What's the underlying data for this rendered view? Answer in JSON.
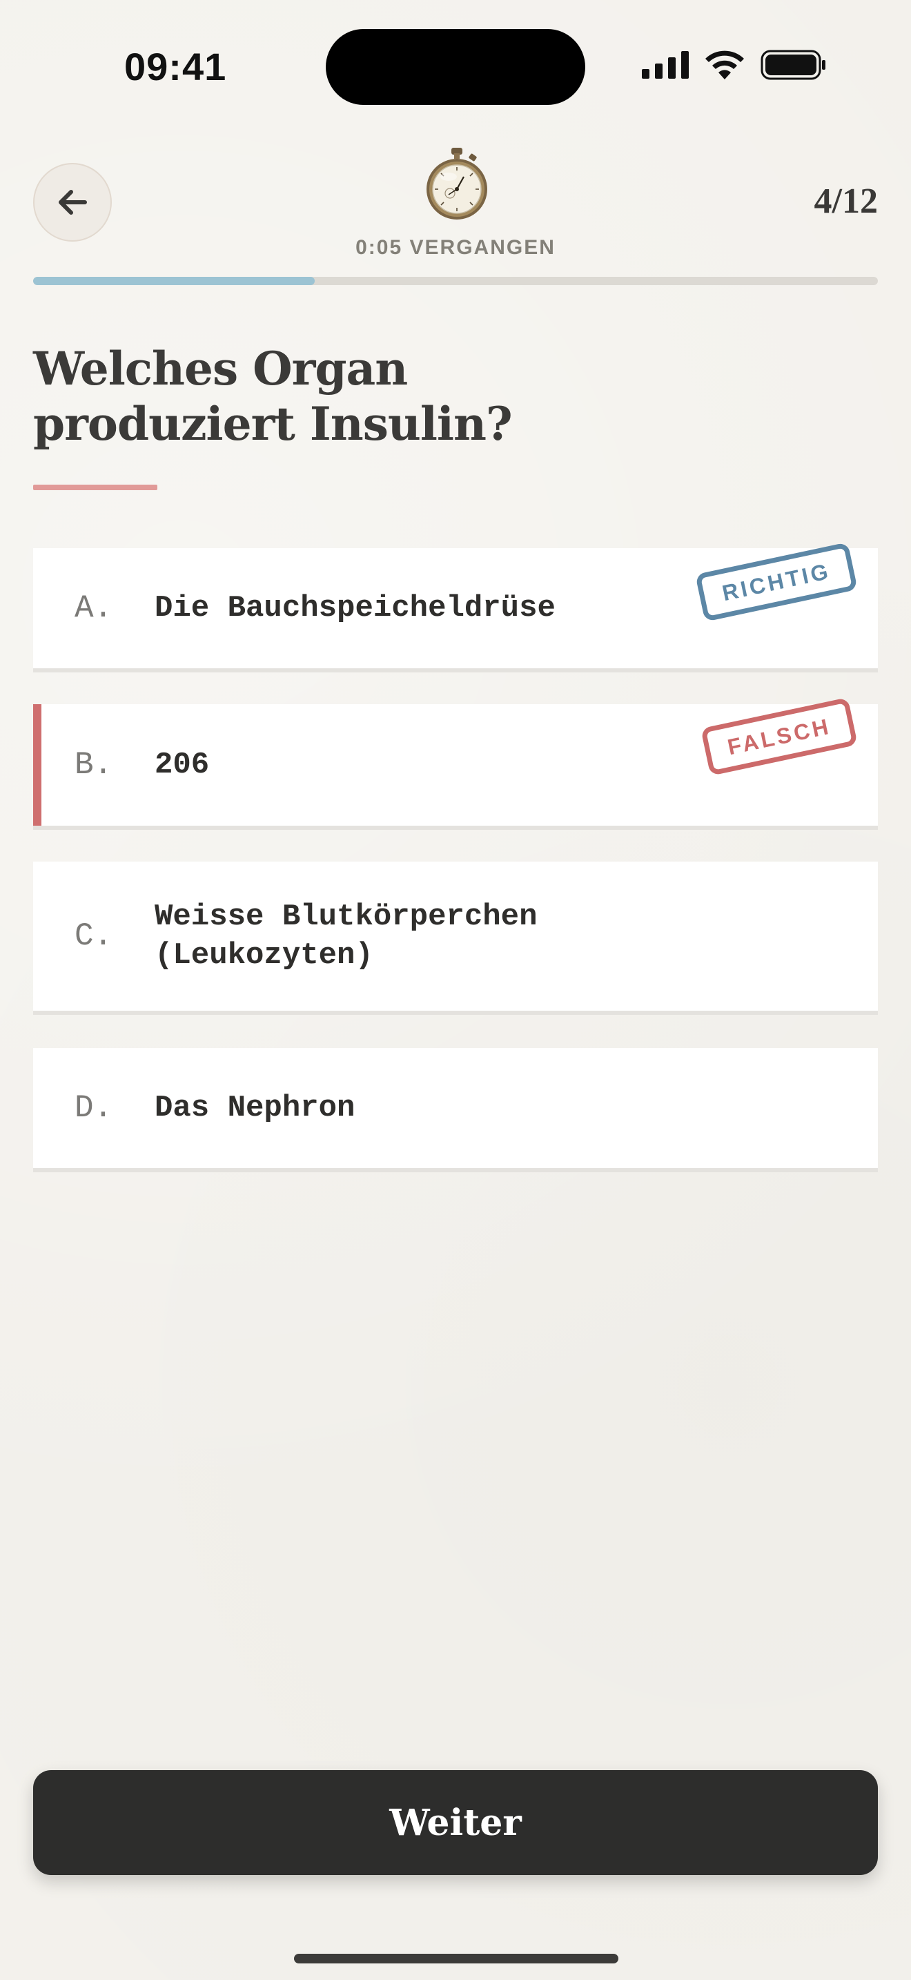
{
  "status_bar": {
    "time": "09:41"
  },
  "header": {
    "back_icon": "arrow-left-icon",
    "timer_icon": "stopwatch-icon",
    "elapsed": "0:05 VERGANGEN",
    "counter": "4/12",
    "progress": 0.333
  },
  "question": {
    "text": "Welches Organ produziert Insulin?"
  },
  "options": [
    {
      "letter": "A.",
      "text": "Die Bauchspeicheldrüse",
      "stamp": "RICHTIG",
      "state": "correct"
    },
    {
      "letter": "B.",
      "text": "206",
      "stamp": "FALSCH",
      "state": "wrong"
    },
    {
      "letter": "C.",
      "text": "Weisse Blutkörperchen (Leukozyten)",
      "state": "neutral"
    },
    {
      "letter": "D.",
      "text": "Das Nephron",
      "state": "neutral"
    }
  ],
  "footer": {
    "next_label": "Weiter"
  },
  "colors": {
    "correct": "#5c87a6",
    "wrong": "#cc6a6a",
    "progress": "#9cc3d3",
    "accent_underline": "#e19a98"
  }
}
